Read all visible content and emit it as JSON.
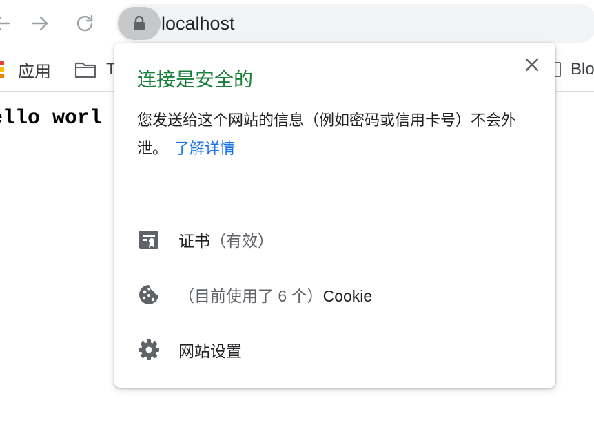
{
  "browser": {
    "url": "localhost",
    "bookmarks": {
      "apps_label": "应用",
      "folder_label": "T",
      "right_label": "Blo"
    }
  },
  "page": {
    "content_text": "ello worl"
  },
  "site_info_popup": {
    "title": "连接是安全的",
    "description": "您发送给这个网站的信息（例如密码或信用卡号）不会外泄。",
    "learn_more_link": "了解详情",
    "certificate_label": "证书",
    "certificate_status": "（有效）",
    "cookies_prefix": "（目前使用了 6 个）",
    "cookies_label": "Cookie",
    "site_settings_label": "网站设置"
  },
  "colors": {
    "secure_green": "#188038",
    "link_blue": "#1a73e8",
    "icon_gray": "#5f6368"
  },
  "icons": {
    "back": "arrow-left-icon",
    "forward": "arrow-right-icon",
    "reload": "reload-icon",
    "lock": "lock-icon",
    "close": "close-icon",
    "certificate": "certificate-icon",
    "cookie": "cookie-icon",
    "settings": "gear-icon"
  }
}
